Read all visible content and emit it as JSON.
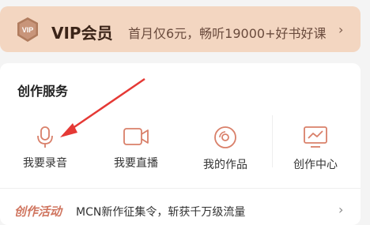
{
  "vip": {
    "badge_text": "VIP",
    "title": "VIP会员",
    "promo": "首月仅6元，畅听19000+好书好课",
    "chevron": "›"
  },
  "creation": {
    "title": "创作服务",
    "services": [
      {
        "label": "我要录音",
        "icon": "microphone-icon"
      },
      {
        "label": "我要直播",
        "icon": "video-camera-icon"
      },
      {
        "label": "我的作品",
        "icon": "disc-icon"
      },
      {
        "label": "创作中心",
        "icon": "monitor-chart-icon"
      }
    ]
  },
  "activity": {
    "tag": "创作活动",
    "text": "MCN新作征集令，斩获千万级流量",
    "chevron": "›"
  },
  "colors": {
    "icon_accent": "#d9806a",
    "vip_bg": "#f3d6c1",
    "annotation_arrow": "#e53935"
  }
}
